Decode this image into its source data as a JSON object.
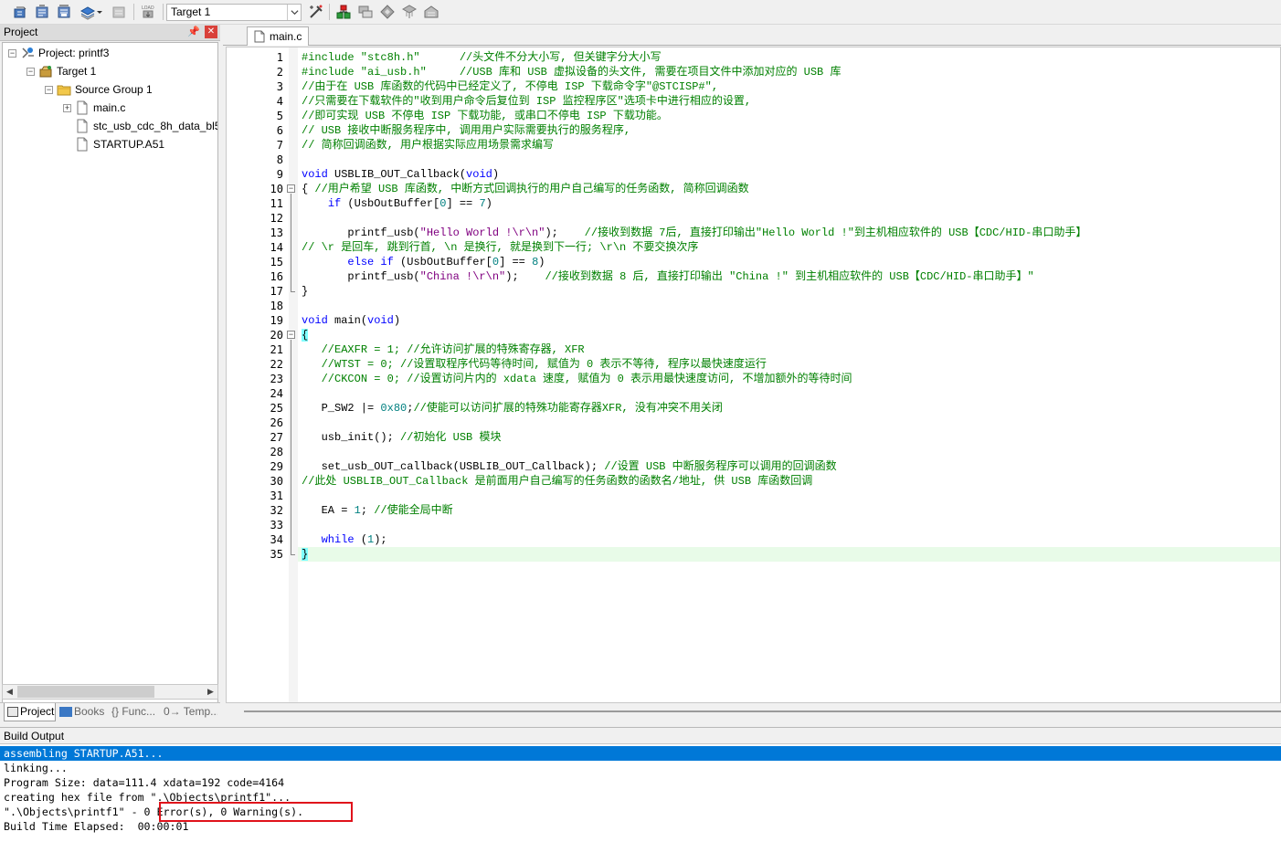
{
  "toolbar": {
    "target_value": "Target 1",
    "load_label": "LOAD"
  },
  "project_panel": {
    "title": "Project",
    "tree": {
      "project": "Project: printf3",
      "target": "Target 1",
      "group": "Source Group 1",
      "files": [
        "main.c",
        "stc_usb_cdc_8h_data_bl5",
        "STARTUP.A51"
      ]
    },
    "tabs": [
      "Project",
      "Books",
      "{} Func...",
      "0→ Temp..."
    ]
  },
  "editor": {
    "tab_label": "main.c",
    "current_line": 35,
    "lines": [
      {
        "n": "1",
        "segs": [
          [
            "#include \"stc8h.h\"      ",
            "pp"
          ],
          [
            "//头文件不分大小写, 但关键字分大小写",
            "cm"
          ]
        ]
      },
      {
        "n": "2",
        "segs": [
          [
            "#include \"ai_usb.h\"     ",
            "pp"
          ],
          [
            "//USB 库和 USB 虚拟设备的头文件, 需要在项目文件中添加对应的 USB 库",
            "cm"
          ]
        ]
      },
      {
        "n": "3",
        "segs": [
          [
            "//由于在 USB 库函数的代码中已经定义了, 不停电 ISP 下载命令字\"@STCISP#\",",
            "cm"
          ]
        ]
      },
      {
        "n": "4",
        "segs": [
          [
            "//只需要在下载软件的\"收到用户命令后复位到 ISP 监控程序区\"选项卡中进行相应的设置,",
            "cm"
          ]
        ]
      },
      {
        "n": "5",
        "segs": [
          [
            "//即可实现 USB 不停电 ISP 下载功能, 或串口不停电 ISP 下载功能。",
            "cm"
          ]
        ]
      },
      {
        "n": "6",
        "segs": [
          [
            "// USB 接收中断服务程序中, 调用用户实际需要执行的服务程序,",
            "cm"
          ]
        ]
      },
      {
        "n": "7",
        "segs": [
          [
            "// 简称回调函数, 用户根据实际应用场景需求编写",
            "cm"
          ]
        ]
      },
      {
        "n": "8",
        "segs": []
      },
      {
        "n": "9",
        "segs": [
          [
            "void",
            "kw"
          ],
          [
            " USBLIB_OUT_Callback(",
            "tx"
          ],
          [
            "void",
            "kw"
          ],
          [
            ")",
            "tx"
          ]
        ]
      },
      {
        "n": "10",
        "segs": [
          [
            "{ ",
            "tx"
          ],
          [
            "//用户希望 USB 库函数, 中断方式回调执行的用户自己编写的任务函数, 简称回调函数",
            "cm"
          ]
        ]
      },
      {
        "n": "11",
        "segs": [
          [
            "    ",
            "tx"
          ],
          [
            "if",
            "kw"
          ],
          [
            " (UsbOutBuffer[",
            "tx"
          ],
          [
            "0",
            "num"
          ],
          [
            "] == ",
            "tx"
          ],
          [
            "7",
            "num"
          ],
          [
            ")",
            "tx"
          ]
        ]
      },
      {
        "n": "12",
        "segs": []
      },
      {
        "n": "13",
        "segs": [
          [
            "       printf_usb(",
            "tx"
          ],
          [
            "\"Hello World !\\r\\n\"",
            "str"
          ],
          [
            ");    ",
            "tx"
          ],
          [
            "//接收到数据 7后, 直接打印输出\"Hello World !\"到主机相应软件的 USB【CDC/HID-串口助手】",
            "cm"
          ]
        ]
      },
      {
        "n": "14",
        "segs": [
          [
            "// \\r 是回车, 跳到行首, \\n 是换行, 就是换到下一行; \\r\\n 不要交换次序",
            "cm"
          ]
        ]
      },
      {
        "n": "15",
        "segs": [
          [
            "       ",
            "tx"
          ],
          [
            "else if",
            "kw"
          ],
          [
            " (UsbOutBuffer[",
            "tx"
          ],
          [
            "0",
            "num"
          ],
          [
            "] == ",
            "tx"
          ],
          [
            "8",
            "num"
          ],
          [
            ")",
            "tx"
          ]
        ]
      },
      {
        "n": "16",
        "segs": [
          [
            "       printf_usb(",
            "tx"
          ],
          [
            "\"China !\\r\\n\"",
            "str"
          ],
          [
            ");    ",
            "tx"
          ],
          [
            "//接收到数据 8 后, 直接打印输出 \"China !\" 到主机相应软件的 USB【CDC/HID-串口助手】\"",
            "cm"
          ]
        ]
      },
      {
        "n": "17",
        "segs": [
          [
            "}",
            "tx"
          ]
        ]
      },
      {
        "n": "18",
        "segs": []
      },
      {
        "n": "19",
        "segs": [
          [
            "void",
            "kw"
          ],
          [
            " main(",
            "tx"
          ],
          [
            "void",
            "kw"
          ],
          [
            ")",
            "tx"
          ]
        ]
      },
      {
        "n": "20",
        "segs": [
          [
            "{",
            "brace"
          ]
        ]
      },
      {
        "n": "21",
        "segs": [
          [
            "   ",
            "tx"
          ],
          [
            "//EAXFR = 1; //允许访问扩展的特殊寄存器, XFR",
            "cm"
          ]
        ]
      },
      {
        "n": "22",
        "segs": [
          [
            "   ",
            "tx"
          ],
          [
            "//WTST = 0; //设置取程序代码等待时间, 赋值为 0 表示不等待, 程序以最快速度运行",
            "cm"
          ]
        ]
      },
      {
        "n": "23",
        "segs": [
          [
            "   ",
            "tx"
          ],
          [
            "//CKCON = 0; //设置访问片内的 xdata 速度, 赋值为 0 表示用最快速度访问, 不增加额外的等待时间",
            "cm"
          ]
        ]
      },
      {
        "n": "24",
        "segs": []
      },
      {
        "n": "25",
        "segs": [
          [
            "   P_SW2 |= ",
            "tx"
          ],
          [
            "0x80",
            "num"
          ],
          [
            ";",
            "tx"
          ],
          [
            "//使能可以访问扩展的特殊功能寄存器XFR, 没有冲突不用关闭",
            "cm"
          ]
        ]
      },
      {
        "n": "26",
        "segs": []
      },
      {
        "n": "27",
        "segs": [
          [
            "   usb_init(); ",
            "tx"
          ],
          [
            "//初始化 USB 模块",
            "cm"
          ]
        ]
      },
      {
        "n": "28",
        "segs": []
      },
      {
        "n": "29",
        "segs": [
          [
            "   set_usb_OUT_callback(USBLIB_OUT_Callback); ",
            "tx"
          ],
          [
            "//设置 USB 中断服务程序可以调用的回调函数",
            "cm"
          ]
        ]
      },
      {
        "n": "30",
        "segs": [
          [
            "//此处 USBLIB_OUT_Callback 是前面用户自己编写的任务函数的函数名/地址, 供 USB 库函数回调",
            "cm"
          ]
        ]
      },
      {
        "n": "31",
        "segs": []
      },
      {
        "n": "32",
        "segs": [
          [
            "   EA = ",
            "tx"
          ],
          [
            "1",
            "num"
          ],
          [
            "; ",
            "tx"
          ],
          [
            "//使能全局中断",
            "cm"
          ]
        ]
      },
      {
        "n": "33",
        "segs": []
      },
      {
        "n": "34",
        "segs": [
          [
            "   ",
            "tx"
          ],
          [
            "while",
            "kw"
          ],
          [
            " (",
            "tx"
          ],
          [
            "1",
            "num"
          ],
          [
            ");",
            "tx"
          ]
        ]
      },
      {
        "n": "35",
        "segs": [
          [
            "}",
            "brace"
          ]
        ]
      }
    ]
  },
  "build_output": {
    "title": "Build Output",
    "lines": [
      "assembling STARTUP.A51...",
      "linking...",
      "Program Size: data=111.4 xdata=192 code=4164",
      "creating hex file from \".\\Objects\\printf1\"...",
      "\".\\Objects\\printf1\" - 0 Error(s), 0 Warning(s).",
      "Build Time Elapsed:  00:00:01"
    ],
    "selected_line": 0
  },
  "colors": {
    "comment": "#008000",
    "keyword": "#0000ff",
    "preprocessor": "#008000",
    "string": "#800080",
    "number": "#008080",
    "selection": "#0078d7",
    "highlight_box": "#e0121b",
    "current_line": "#e8fbe8"
  }
}
